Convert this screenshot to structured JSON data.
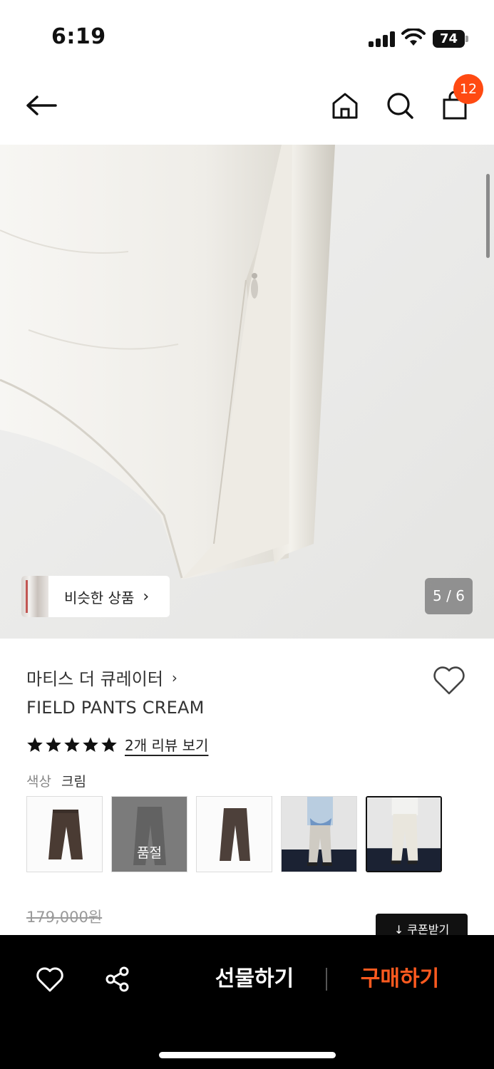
{
  "status_bar": {
    "time": "6:19",
    "battery": "74"
  },
  "nav": {
    "cart_count": "12"
  },
  "hero": {
    "similar_label": "비슷한 상품",
    "page_indicator": "5 / 6"
  },
  "product": {
    "brand": "마티스 더 큐레이터",
    "name": "FIELD PANTS CREAM",
    "rating": 5,
    "review_link": "2개 리뷰 보기",
    "color_label": "색상",
    "color_value": "크림",
    "color_options": [
      {
        "name": "brown-pants-1",
        "soldout_label": ""
      },
      {
        "name": "grey-pants",
        "soldout_label": "품절"
      },
      {
        "name": "brown-pants-2",
        "soldout_label": ""
      },
      {
        "name": "model-blue",
        "soldout_label": ""
      },
      {
        "name": "model-cream",
        "soldout_label": ""
      }
    ],
    "price_original": "179,000원",
    "coupon_label": "↓ 쿠폰받기"
  },
  "bottom_bar": {
    "gift_label": "선물하기",
    "buy_label": "구매하기"
  },
  "colors": {
    "accent": "#ff4a12",
    "buy": "#ff5a1f"
  }
}
